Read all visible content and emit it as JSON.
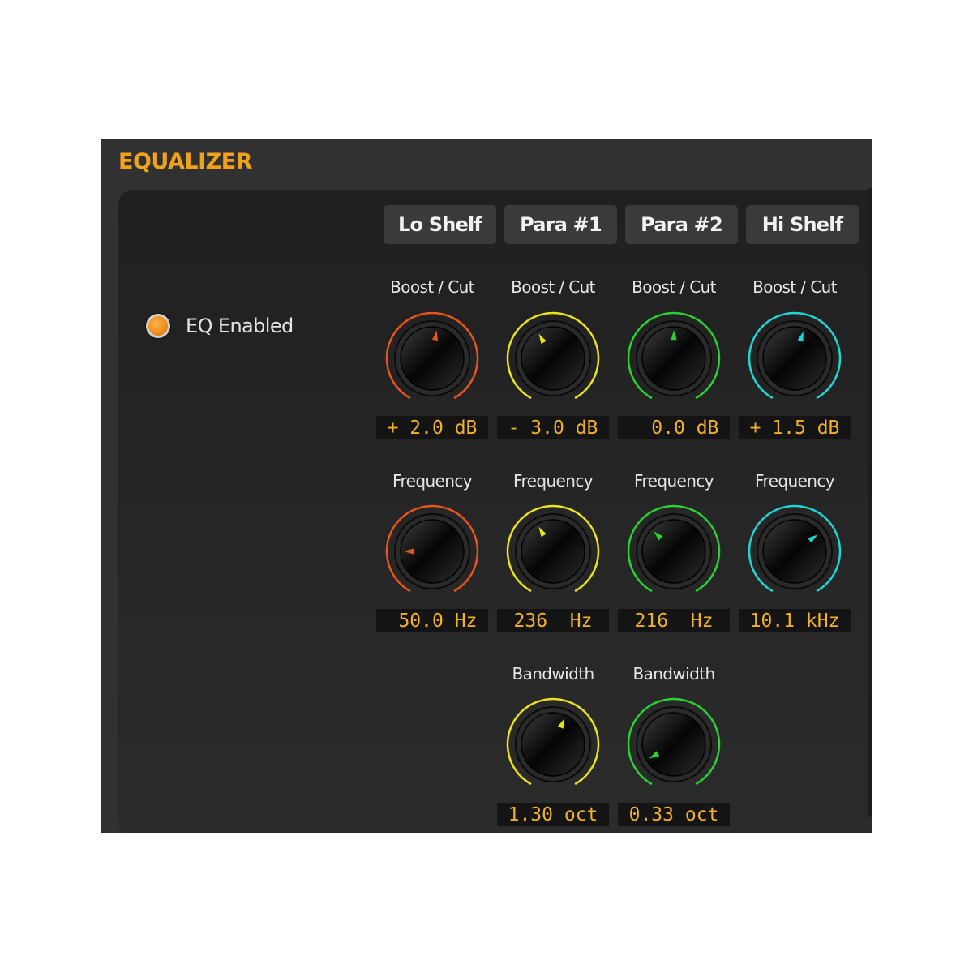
{
  "panel": {
    "title": "EQUALIZER"
  },
  "toggle": {
    "label": "EQ Enabled",
    "led_color": "#ef8f1e"
  },
  "colors": {
    "readout_text": "#f0b028",
    "title": "#f0a21e"
  },
  "bands": [
    {
      "name": "Lo Shelf",
      "color": "#e8541c",
      "knobs": [
        {
          "label": "Boost / Cut",
          "readout": "+ 2.0 dB",
          "position": 0.53
        },
        {
          "label": "Frequency",
          "readout": " 50.0 Hz",
          "position": 0.2
        }
      ]
    },
    {
      "name": "Para #1",
      "color": "#e9e319",
      "knobs": [
        {
          "label": "Boost / Cut",
          "readout": "- 3.0 dB",
          "position": 0.4
        },
        {
          "label": "Frequency",
          "readout": "236  Hz",
          "position": 0.4
        },
        {
          "label": "Bandwidth",
          "readout": "1.30 oct",
          "position": 0.58
        }
      ]
    },
    {
      "name": "Para #2",
      "color": "#27d232",
      "knobs": [
        {
          "label": "Boost / Cut",
          "readout": "  0.0 dB",
          "position": 0.5
        },
        {
          "label": "Frequency",
          "readout": "216  Hz",
          "position": 0.35
        },
        {
          "label": "Bandwidth",
          "readout": "0.33 oct",
          "position": 0.1
        }
      ]
    },
    {
      "name": "Hi Shelf",
      "color": "#1fd6d6",
      "knobs": [
        {
          "label": "Boost / Cut",
          "readout": "+ 1.5 dB",
          "position": 0.56
        },
        {
          "label": "Frequency",
          "readout": "10.1 kHz",
          "position": 0.68
        }
      ]
    }
  ]
}
